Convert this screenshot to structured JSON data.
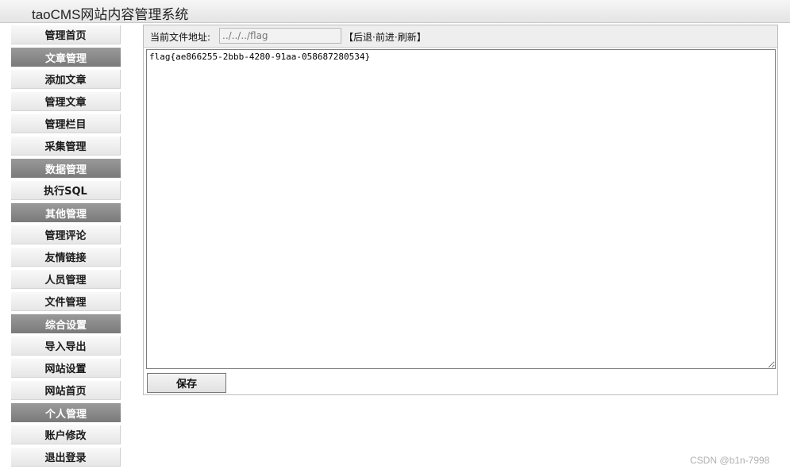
{
  "app": {
    "title": "taoCMS网站内容管理系统"
  },
  "sidebar": {
    "items": [
      {
        "label": "管理首页",
        "type": "item"
      },
      {
        "label": "文章管理",
        "type": "category"
      },
      {
        "label": "添加文章",
        "type": "item"
      },
      {
        "label": "管理文章",
        "type": "item"
      },
      {
        "label": "管理栏目",
        "type": "item"
      },
      {
        "label": "采集管理",
        "type": "item"
      },
      {
        "label": "数据管理",
        "type": "category"
      },
      {
        "label": "执行SQL",
        "type": "item"
      },
      {
        "label": "其他管理",
        "type": "category"
      },
      {
        "label": "管理评论",
        "type": "item"
      },
      {
        "label": "友情链接",
        "type": "item"
      },
      {
        "label": "人员管理",
        "type": "item"
      },
      {
        "label": "文件管理",
        "type": "item"
      },
      {
        "label": "综合设置",
        "type": "category"
      },
      {
        "label": "导入导出",
        "type": "item"
      },
      {
        "label": "网站设置",
        "type": "item"
      },
      {
        "label": "网站首页",
        "type": "item"
      },
      {
        "label": "个人管理",
        "type": "category"
      },
      {
        "label": "账户修改",
        "type": "item"
      },
      {
        "label": "退出登录",
        "type": "item"
      }
    ]
  },
  "file": {
    "path_label": "当前文件地址:",
    "path_value": "../../../flag",
    "nav_open": "【",
    "nav_back": "后退",
    "nav_sep1": "·",
    "nav_forward": "前进",
    "nav_sep2": "·",
    "nav_refresh": "刷新",
    "nav_close": "】",
    "content": "flag{ae866255-2bbb-4280-91aa-058687280534}",
    "save_label": "保存"
  },
  "watermark": "CSDN @b1n-7998",
  "colors": {
    "category_bg": "#8a8a8a",
    "item_bg": "#eeeeee",
    "header_bg": "#eeeeee"
  }
}
